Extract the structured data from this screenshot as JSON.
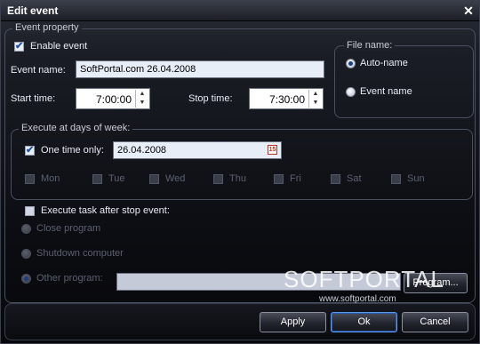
{
  "dialog": {
    "title": "Edit event"
  },
  "event_property": {
    "legend": "Event property",
    "enable_event_label": "Enable event",
    "enable_event_checked": true,
    "event_name_label": "Event name:",
    "event_name_value": "SoftPortal.com 26.04.2008",
    "start_time_label": "Start time:",
    "start_time_value": "7:00:00",
    "stop_time_label": "Stop time:",
    "stop_time_value": "7:30:00"
  },
  "file_name": {
    "legend": "File name:",
    "auto_name_label": "Auto-name",
    "event_name_option_label": "Event name",
    "selected": "Auto-name"
  },
  "execute_days": {
    "legend": "Execute at days of week:",
    "one_time_label": "One time only:",
    "one_time_checked": true,
    "date_value": "26.04.2008",
    "calendar_icon_text": "15",
    "days": [
      "Mon",
      "Tue",
      "Wed",
      "Thu",
      "Fri",
      "Sat",
      "Sun"
    ]
  },
  "after_stop": {
    "execute_task_label": "Execute task after stop event:",
    "close_program_label": "Close program",
    "shutdown_label": "Shutdown computer",
    "other_program_label": "Other program:",
    "other_program_value": "",
    "program_button_label": "Program..."
  },
  "watermark": {
    "logo_text": "SOFTPORTAL",
    "url": "www.softportal.com"
  },
  "footer": {
    "apply_label": "Apply",
    "ok_label": "Ok",
    "cancel_label": "Cancel"
  },
  "colors": {
    "accent": "#5a9ae8",
    "background": "#0c0d12",
    "text": "#e8ecf4"
  }
}
